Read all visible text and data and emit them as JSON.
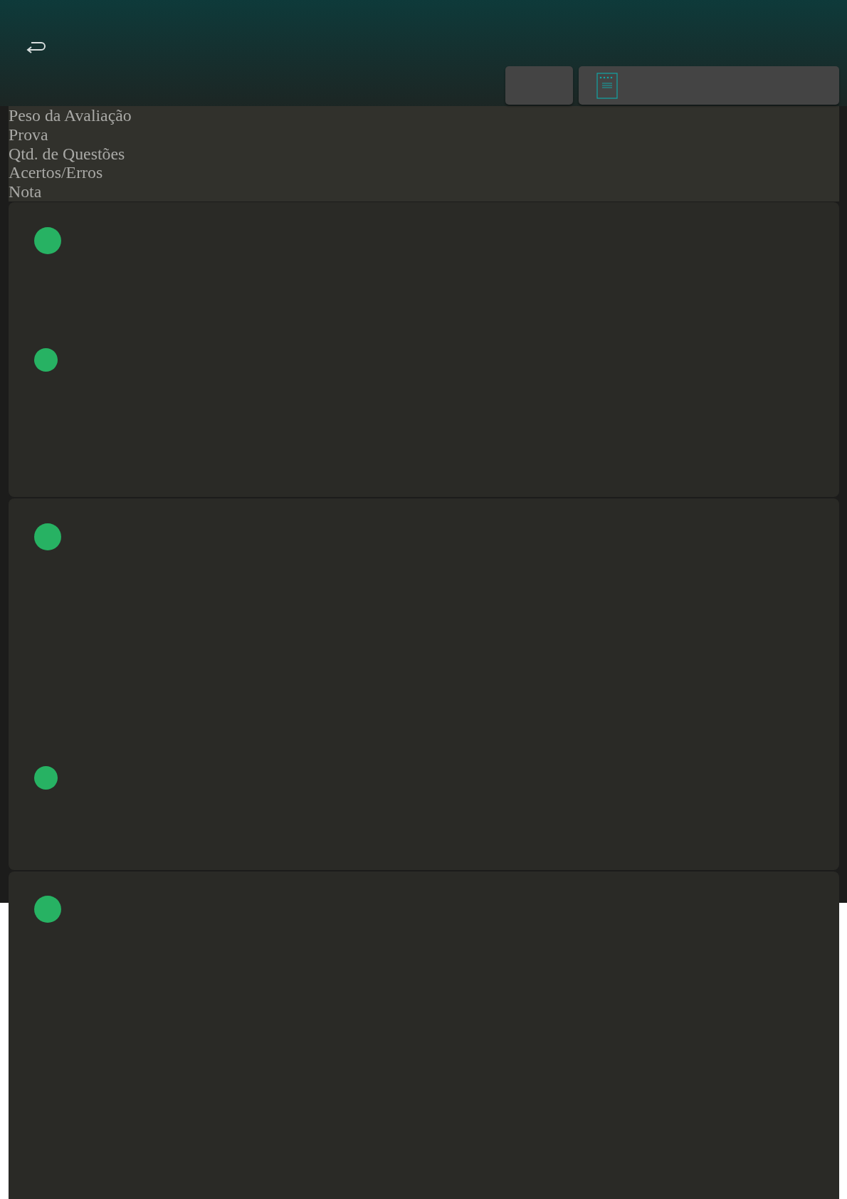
{
  "toolbar": {
    "buttons": [
      {
        "kind": "blank"
      },
      {
        "kind": "document"
      }
    ]
  },
  "columns": [
    "Peso da Avaliação",
    "Prova",
    "Qtd. de Questões",
    "Acertos/Erros",
    "Nota"
  ],
  "cards": [
    {
      "dots": [
        {
          "color": "#27b263",
          "kind": "large"
        },
        {
          "color": "#27b263",
          "kind": "small"
        }
      ]
    },
    {
      "dots": [
        {
          "color": "#27b263",
          "kind": "large"
        },
        {
          "color": "#27b263",
          "kind": "small"
        }
      ]
    },
    {
      "dots": [
        {
          "color": "#27b263",
          "kind": "large"
        }
      ]
    }
  ]
}
